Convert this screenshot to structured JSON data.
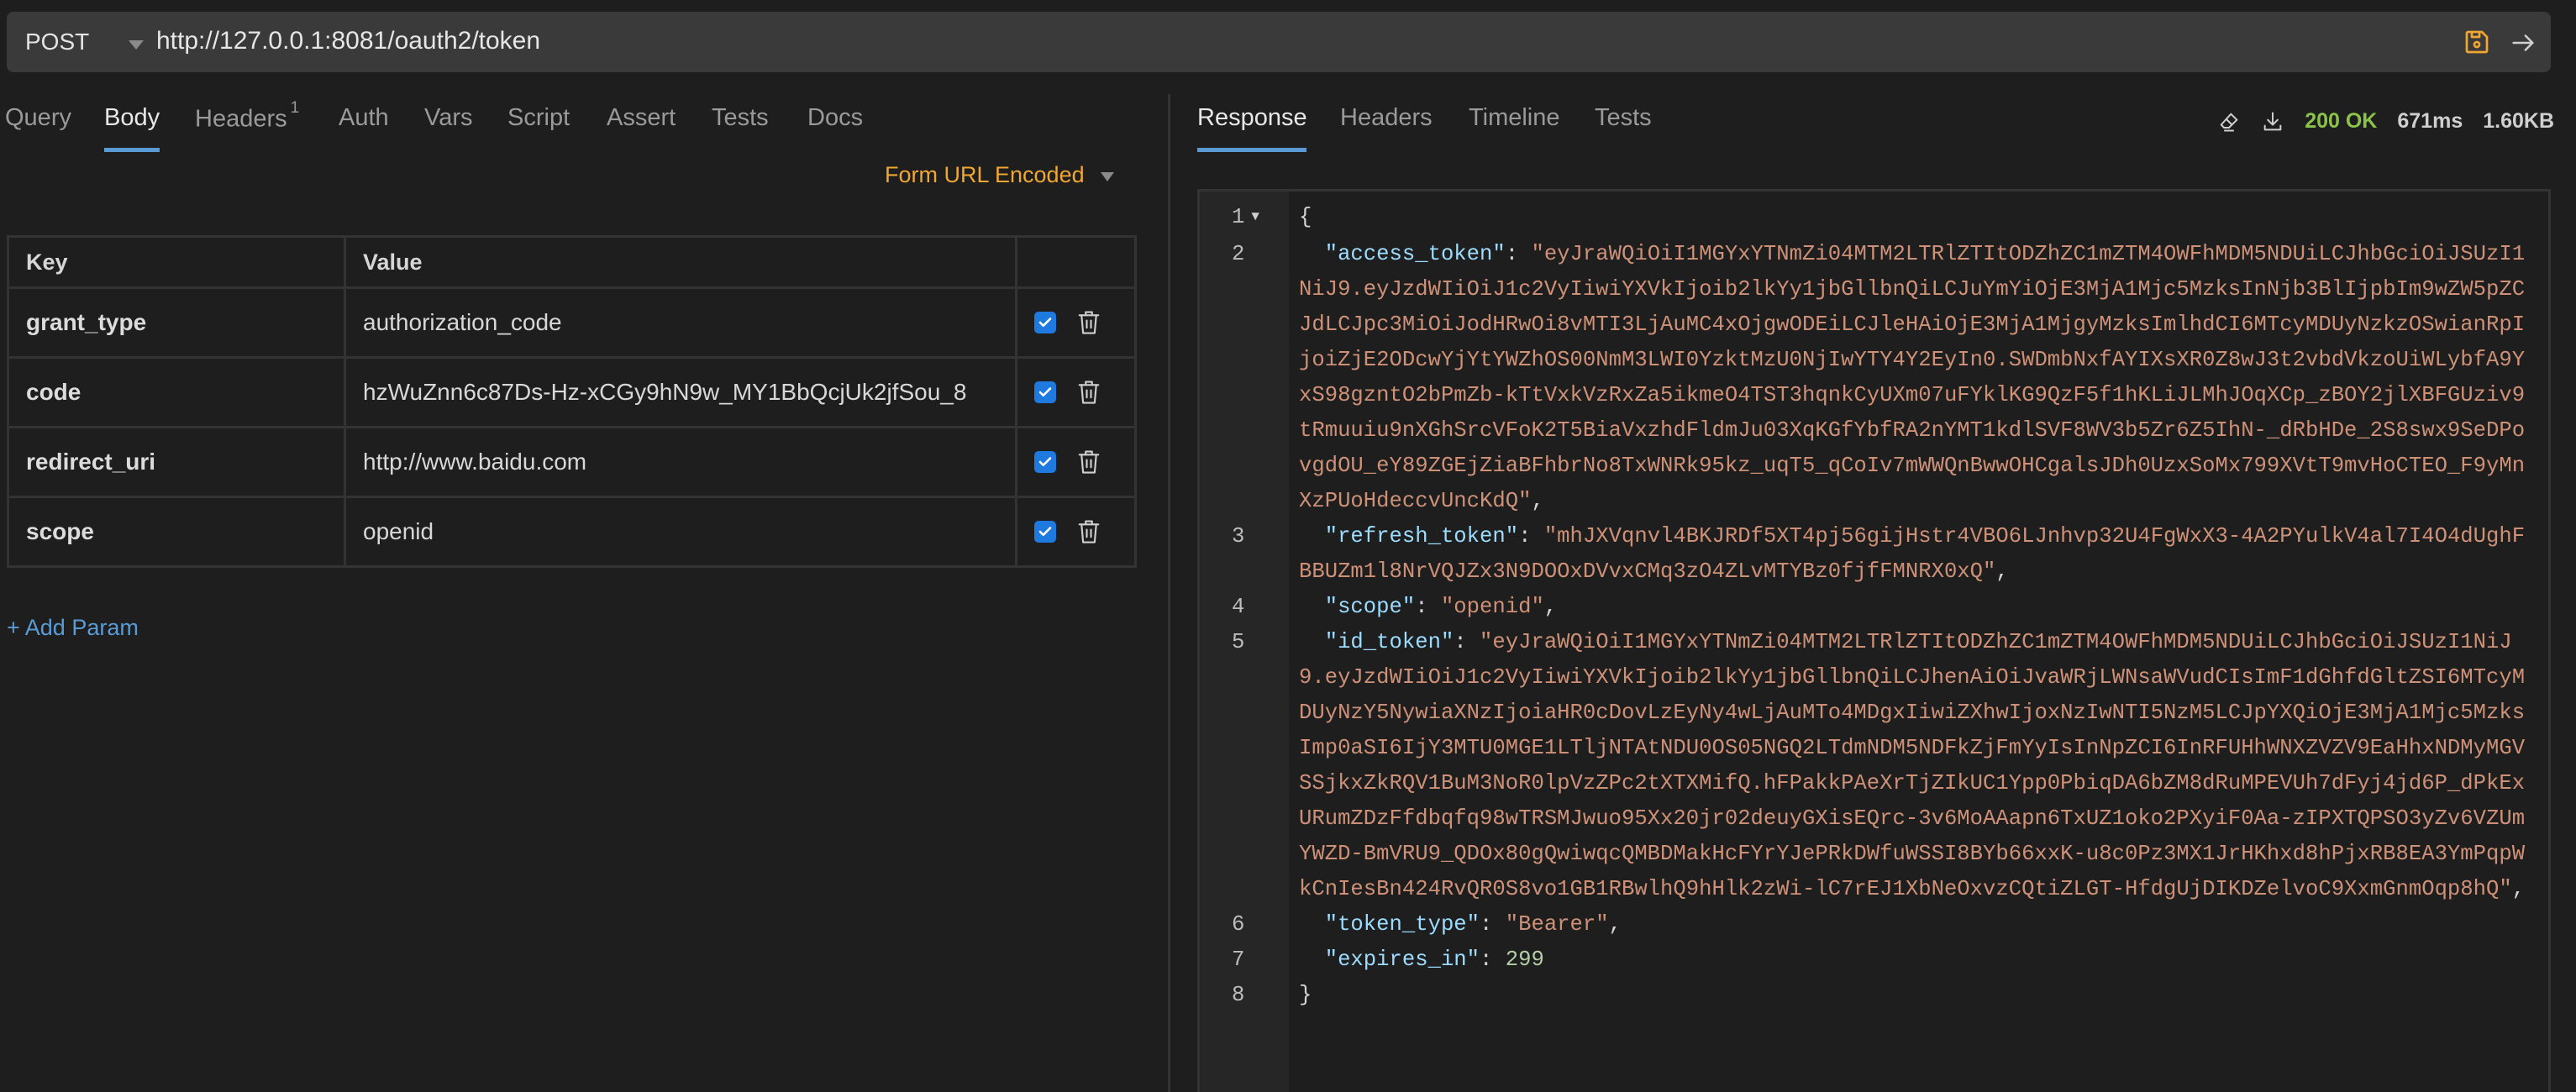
{
  "request": {
    "method": "POST",
    "url": "http://127.0.0.1:8081/oauth2/token"
  },
  "request_tabs": [
    {
      "label": "Query",
      "active": false
    },
    {
      "label": "Body",
      "active": true
    },
    {
      "label": "Headers",
      "badge": "1",
      "active": false
    },
    {
      "label": "Auth",
      "active": false
    },
    {
      "label": "Vars",
      "active": false
    },
    {
      "label": "Script",
      "active": false
    },
    {
      "label": "Assert",
      "active": false
    },
    {
      "label": "Tests",
      "active": false
    },
    {
      "label": "Docs",
      "active": false
    }
  ],
  "body_mode": "Form URL Encoded",
  "params_table": {
    "headers": {
      "key": "Key",
      "value": "Value"
    },
    "rows": [
      {
        "key": "grant_type",
        "value": "authorization_code",
        "enabled": true
      },
      {
        "key": "code",
        "value": "hzWuZnn6c87Ds-Hz-xCGy9hN9w_MY1BbQcjUk2jfSou_8",
        "enabled": true
      },
      {
        "key": "redirect_uri",
        "value": "http://www.baidu.com",
        "enabled": true
      },
      {
        "key": "scope",
        "value": "openid",
        "enabled": true
      }
    ],
    "add_label": "+ Add Param"
  },
  "response_tabs": [
    {
      "label": "Response",
      "active": true
    },
    {
      "label": "Headers",
      "active": false
    },
    {
      "label": "Timeline",
      "active": false
    },
    {
      "label": "Tests",
      "active": false
    }
  ],
  "response_meta": {
    "status": "200 OK",
    "time": "671ms",
    "size": "1.60KB",
    "status_color": "#8bc34a"
  },
  "response_body": {
    "access_token": "eyJraWQiOiI1MGYxYTNmZi04MTM2LTRlZTItODZhZC1mZTM4OWFhMDM5NDUiLCJhbGciOiJSUzI1NiJ9.eyJzdWIiOiJ1c2VyIiwiYXVkIjoib2lkYy1jbGllbnQiLCJuYmYiOjE3MjA1Mjc5MzksInNjb3BlIjpbIm9wZW5pZCJdLCJpc3MiOiJodHRwOi8vMTI3LjAuMC4xOjgwODEiLCJleHAiOjE3MjA1MjgyMzksImlhdCI6MTcyMDUyNzkzOSwianRpIjoiZjE2ODcwYjYtYWZhOS00NmM3LWI0YzktMzU0NjIwYTY4Y2EyIn0.SWDmbNxfAYIXsXR0Z8wJ3t2vbdVkzoUiWLybfA9YxS98gzntO2bPmZb-kTtVxkVzRxZa5ikmeO4TST3hqnkCyUXm07uFYklKG9QzF5f1hKLiJLMhJOqXCp_zBOY2jlXBFGUziv9tRmuuiu9nXGhSrcVFoK2T5BiaVxzhdFldmJu03XqKGfYbfRA2nYMT1kdlSVF8WV3b5Zr6Z5IhN-_dRbHDe_2S8swx9SeDPovgdOU_eY89ZGEjZiaBFhbrNo8TxWNRk95kz_uqT5_qCoIv7mWWQnBwwOHCgalsJDh0UzxSoMx799XVtT9mvHoCTEO_F9yMnXzPUoHdeccvUncKdQ",
    "refresh_token": "mhJXVqnvl4BKJRDf5XT4pj56gijHstr4VBO6LJnhvp32U4FgWxX3-4A2PYulkV4al7I4O4dUghFBBUZm1l8NrVQJZx3N9DOOxDVvxCMq3zO4ZLvMTYBz0fjfFMNRX0xQ",
    "scope": "openid",
    "id_token": "eyJraWQiOiI1MGYxYTNmZi04MTM2LTRlZTItODZhZC1mZTM4OWFhMDM5NDUiLCJhbGciOiJSUzI1NiJ9.eyJzdWIiOiJ1c2VyIiwiYXVkIjoib2lkYy1jbGllbnQiLCJhenAiOiJvaWRjLWNsaWVudCIsImF1dGhfdGltZSI6MTcyMDUyNzY5NywiaXNzIjoiaHR0cDovLzEyNy4wLjAuMTo4MDgxIiwiZXhwIjoxNzIwNTI5NzM5LCJpYXQiOjE3MjA1Mjc5MzksImp0aSI6IjY3MTU0MGE1LTljNTAtNDU0OS05NGQ2LTdmNDM5NDFkZjFmYyIsInNpZCI6InRFUHhWNXZVZV9EaHhxNDMyMGVSSjkxZkRQV1BuM3NoR0lpVzZPc2tXTXMifQ.hFPakkPAeXrTjZIkUC1Ypp0PbiqDA6bZM8dRuMPEVUh7dFyj4jd6P_dPkExURumZDzFfdbqfq98wTRSMJwuo95Xx20jr02deuyGXisEQrc-3v6MoAAapn6TxUZ1oko2PXyiF0Aa-zIPXTQPSO3yZv6VZUmYWZD-BmVRU9_QDOx80gQwiwqcQMBDMakHcFYrYJePRkDWfuWSSI8BYb66xxK-u8c0Pz3MX1JrHKhxd8hPjxRB8EA3YmPqpWkCnIesBn424RvQR0S8vo1GB1RBwlhQ9hHlk2zWi-lC7rEJ1XbNeOxvzCQtiZLGT-HfdgUjDIKDZelvoC9XxmGnmOqp8hQ",
    "token_type": "Bearer",
    "expires_in": 299
  },
  "response_keys": [
    "access_token",
    "refresh_token",
    "scope",
    "id_token",
    "token_type",
    "expires_in"
  ]
}
